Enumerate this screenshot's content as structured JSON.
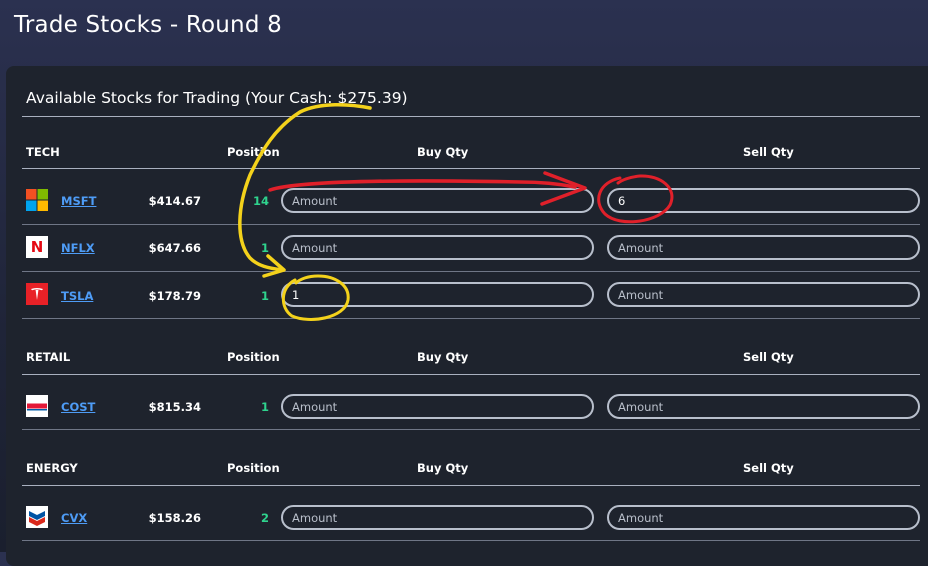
{
  "page": {
    "title": "Trade Stocks - Round 8"
  },
  "panel": {
    "heading": "Available Stocks for Trading (Your Cash: $275.39)"
  },
  "columns": {
    "position": "Position",
    "buy": "Buy Qty",
    "sell": "Sell Qty"
  },
  "sections": [
    {
      "name": "TECH",
      "stocks": [
        {
          "ticker": "MSFT",
          "price": "$414.67",
          "position": "14",
          "buy_value": "",
          "sell_value": "6",
          "logo": "microsoft-logo-icon"
        },
        {
          "ticker": "NFLX",
          "price": "$647.66",
          "position": "1",
          "buy_value": "",
          "sell_value": "",
          "logo": "netflix-logo-icon"
        },
        {
          "ticker": "TSLA",
          "price": "$178.79",
          "position": "1",
          "buy_value": "1",
          "sell_value": "",
          "logo": "tesla-logo-icon"
        }
      ]
    },
    {
      "name": "RETAIL",
      "stocks": [
        {
          "ticker": "COST",
          "price": "$815.34",
          "position": "1",
          "buy_value": "",
          "sell_value": "",
          "logo": "costco-logo-icon"
        }
      ]
    },
    {
      "name": "ENERGY",
      "stocks": [
        {
          "ticker": "CVX",
          "price": "$158.26",
          "position": "2",
          "buy_value": "",
          "sell_value": "",
          "logo": "chevron-logo-icon"
        }
      ]
    }
  ],
  "input_placeholder": "Amount",
  "colors": {
    "background": "#1e232d",
    "position_green": "#2fd38e",
    "ticker_link": "#4e9cf6",
    "annotation_red": "#e0202a",
    "annotation_yellow": "#f4d21b"
  }
}
